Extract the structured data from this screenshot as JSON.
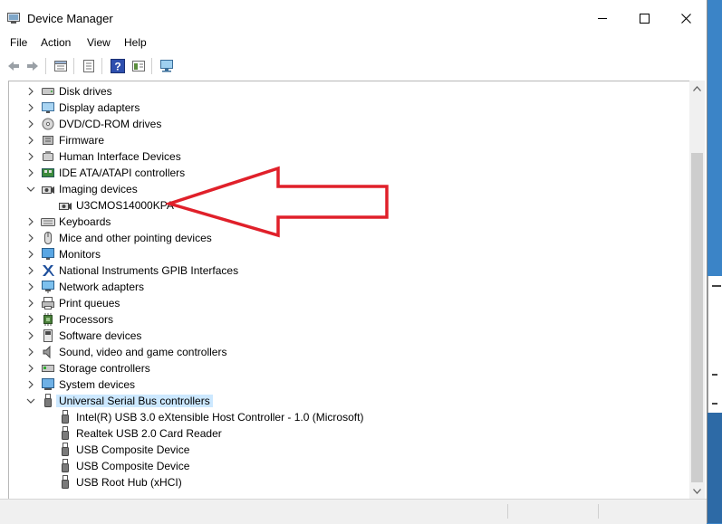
{
  "window": {
    "title": "Device Manager"
  },
  "menu": [
    {
      "label": "File"
    },
    {
      "label": "Action"
    },
    {
      "label": "View"
    },
    {
      "label": "Help"
    }
  ],
  "toolbar": [
    {
      "icon": "back-arrow-icon"
    },
    {
      "icon": "forward-arrow-icon"
    },
    {
      "icon": "properties-icon"
    },
    {
      "icon": "device-list-icon"
    },
    {
      "icon": "help-icon"
    },
    {
      "icon": "view-icon"
    },
    {
      "icon": "monitor-scan-icon"
    }
  ],
  "tree": [
    {
      "label": "Disk drives",
      "level": 0,
      "expander": "collapsed",
      "icon": "disk-drive-icon"
    },
    {
      "label": "Display adapters",
      "level": 0,
      "expander": "collapsed",
      "icon": "display-adapter-icon"
    },
    {
      "label": "DVD/CD-ROM drives",
      "level": 0,
      "expander": "collapsed",
      "icon": "dvd-drive-icon"
    },
    {
      "label": "Firmware",
      "level": 0,
      "expander": "collapsed",
      "icon": "firmware-icon"
    },
    {
      "label": "Human Interface Devices",
      "level": 0,
      "expander": "collapsed",
      "icon": "hid-icon"
    },
    {
      "label": "IDE ATA/ATAPI controllers",
      "level": 0,
      "expander": "collapsed",
      "icon": "ide-controller-icon"
    },
    {
      "label": "Imaging devices",
      "level": 0,
      "expander": "expanded",
      "icon": "camera-icon"
    },
    {
      "label": "U3CMOS14000KPA",
      "level": 1,
      "expander": "none",
      "icon": "camera-icon"
    },
    {
      "label": "Keyboards",
      "level": 0,
      "expander": "collapsed",
      "icon": "keyboard-icon"
    },
    {
      "label": "Mice and other pointing devices",
      "level": 0,
      "expander": "collapsed",
      "icon": "mouse-icon"
    },
    {
      "label": "Monitors",
      "level": 0,
      "expander": "collapsed",
      "icon": "monitor-icon"
    },
    {
      "label": "National Instruments GPIB Interfaces",
      "level": 0,
      "expander": "collapsed",
      "icon": "gpib-icon"
    },
    {
      "label": "Network adapters",
      "level": 0,
      "expander": "collapsed",
      "icon": "network-adapter-icon"
    },
    {
      "label": "Print queues",
      "level": 0,
      "expander": "collapsed",
      "icon": "printer-icon"
    },
    {
      "label": "Processors",
      "level": 0,
      "expander": "collapsed",
      "icon": "processor-icon"
    },
    {
      "label": "Software devices",
      "level": 0,
      "expander": "collapsed",
      "icon": "software-device-icon"
    },
    {
      "label": "Sound, video and game controllers",
      "level": 0,
      "expander": "collapsed",
      "icon": "speaker-icon"
    },
    {
      "label": "Storage controllers",
      "level": 0,
      "expander": "collapsed",
      "icon": "storage-controller-icon"
    },
    {
      "label": "System devices",
      "level": 0,
      "expander": "collapsed",
      "icon": "system-device-icon"
    },
    {
      "label": "Universal Serial Bus controllers",
      "level": 0,
      "expander": "expanded",
      "icon": "usb-icon",
      "selected": true
    },
    {
      "label": "Intel(R) USB 3.0 eXtensible Host Controller - 1.0 (Microsoft)",
      "level": 1,
      "expander": "none",
      "icon": "usb-icon"
    },
    {
      "label": "Realtek USB 2.0 Card Reader",
      "level": 1,
      "expander": "none",
      "icon": "usb-icon"
    },
    {
      "label": "USB Composite Device",
      "level": 1,
      "expander": "none",
      "icon": "usb-icon"
    },
    {
      "label": "USB Composite Device",
      "level": 1,
      "expander": "none",
      "icon": "usb-icon"
    },
    {
      "label": "USB Root Hub (xHCI)",
      "level": 1,
      "expander": "none",
      "icon": "usb-icon"
    }
  ],
  "colors": {
    "selection": "#cce8ff",
    "annotation_arrow": "#e0202a",
    "desktop": "#3b84c7"
  }
}
